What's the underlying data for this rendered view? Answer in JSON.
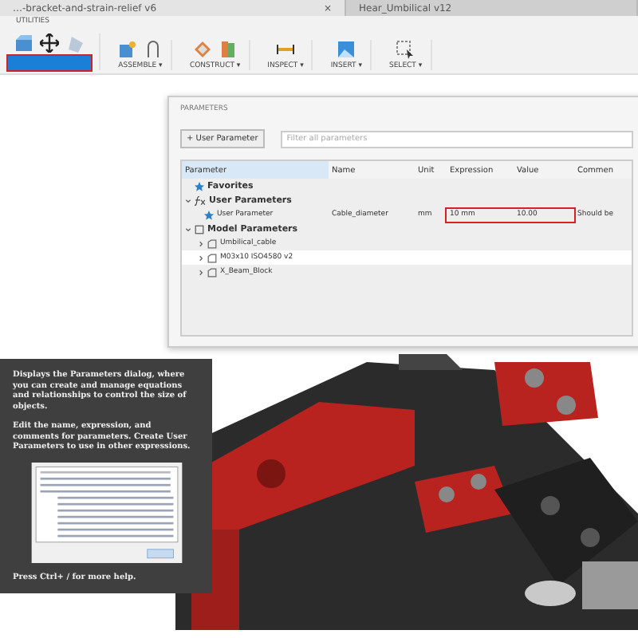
{
  "tabs": [
    {
      "title": "…-bracket-and-strain-relief v6",
      "close": "×",
      "selected": true
    },
    {
      "title": "Hear_Umbilical v12",
      "selected": false
    }
  ],
  "toolbar": {
    "tab": "UTILITIES",
    "highlight": {
      "selected": true
    },
    "groups": [
      {
        "label": "ASSEMBLE ▾"
      },
      {
        "label": "CONSTRUCT ▾"
      },
      {
        "label": "INSPECT ▾"
      },
      {
        "label": "INSERT ▾"
      },
      {
        "label": "SELECT ▾"
      }
    ]
  },
  "dialog": {
    "title": "PARAMETERS",
    "add_button": "+ User Parameter",
    "filter": {
      "placeholder": "Filter all parameters"
    },
    "columns": [
      "Parameter",
      "Name",
      "Unit",
      "Expression",
      "Value",
      "Commen"
    ],
    "rows": [
      {
        "kind": "favorites",
        "label": "Favorites"
      },
      {
        "kind": "user-group",
        "label": "User Parameters",
        "expanded": true
      },
      {
        "kind": "param",
        "label": "User Parameter",
        "name": "Cable_diameter",
        "unit": "mm",
        "expression": "10 mm",
        "value": "10.00",
        "comment": "Should be",
        "highlighted": true
      },
      {
        "kind": "model-group",
        "label": "Model Parameters",
        "expanded": true
      },
      {
        "kind": "component",
        "label": "Umbilical_cable",
        "selected": false
      },
      {
        "kind": "component",
        "label": "M03x10 ISO4580 v2",
        "selected": true
      },
      {
        "kind": "component",
        "label": "X_Beam_Block",
        "selected": false
      }
    ]
  },
  "tooltip": {
    "paragraphs": [
      "Displays the Parameters dialog, where you can create and manage equations and relationships to control the size of objects.",
      "Edit the name, expression, and comments for parameters. Create User Parameters to use in other expressions."
    ],
    "footer": "Press Ctrl+ / for more help."
  }
}
